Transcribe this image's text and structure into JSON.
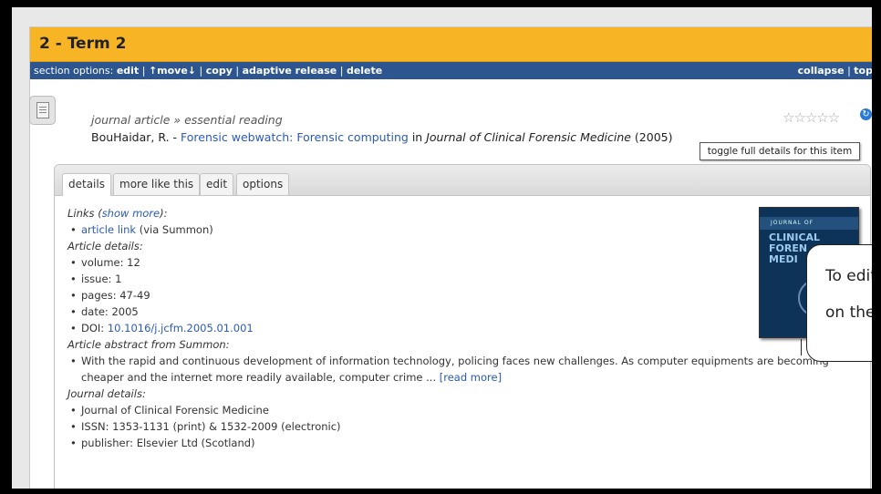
{
  "term": {
    "title": "2 - Term 2"
  },
  "section_bar": {
    "prefix": "section options:",
    "actions": [
      "edit",
      "|",
      "↑move↓",
      "|",
      "copy",
      "|",
      "adaptive release",
      "|",
      "delete"
    ],
    "right": [
      "collapse",
      "|",
      "top"
    ]
  },
  "item": {
    "icon": "document-icon",
    "type": "journal article » essential reading",
    "author": "BouHaidar, R. - ",
    "title_link": "Forensic webwatch: Forensic computing",
    "in_text": " in ",
    "journal": "Journal of Clinical Forensic Medicine",
    "year": " (2005)",
    "rating_stars": "☆☆☆☆☆",
    "refresh_icon": "refresh-icon",
    "tooltip": "toggle full details for this item"
  },
  "tabs": [
    "details",
    "more like this",
    "edit",
    "options"
  ],
  "details": {
    "links_title": "Links (",
    "links_show_more": "show more",
    "links_title_end": "):",
    "article_link": "article link",
    "article_link_via": " (via Summon)",
    "article_details_title": "Article details:",
    "volume": "volume: 12",
    "issue": "issue: 1",
    "pages": "pages: 47-49",
    "date": "date: 2005",
    "doi_label": "DOI: ",
    "doi_value": "10.1016/j.jcfm.2005.01.001",
    "abstract_title": "Article abstract from Summon:",
    "abstract_line1": "With the rapid and continuous development of information technology, policing faces new challenges. As computer equipments are becoming",
    "abstract_line2": "cheaper and the internet more readily available, computer crime ... ",
    "read_more": "[read more]",
    "journal_title": "Journal details:",
    "journal_name": "Journal of Clinical Forensic Medicine",
    "issn": "ISSN: 1353-1131 (print) & 1532-2009 (electronic)",
    "publisher": "publisher: Elsevier Ltd (Scotland)"
  },
  "cover": {
    "line1": "JOURNAL OF",
    "line2": "CLINICAL",
    "line3": "FOREN",
    "line4": "MEDI"
  },
  "callout": {
    "line1": "To edit",
    "line2": "on the"
  }
}
